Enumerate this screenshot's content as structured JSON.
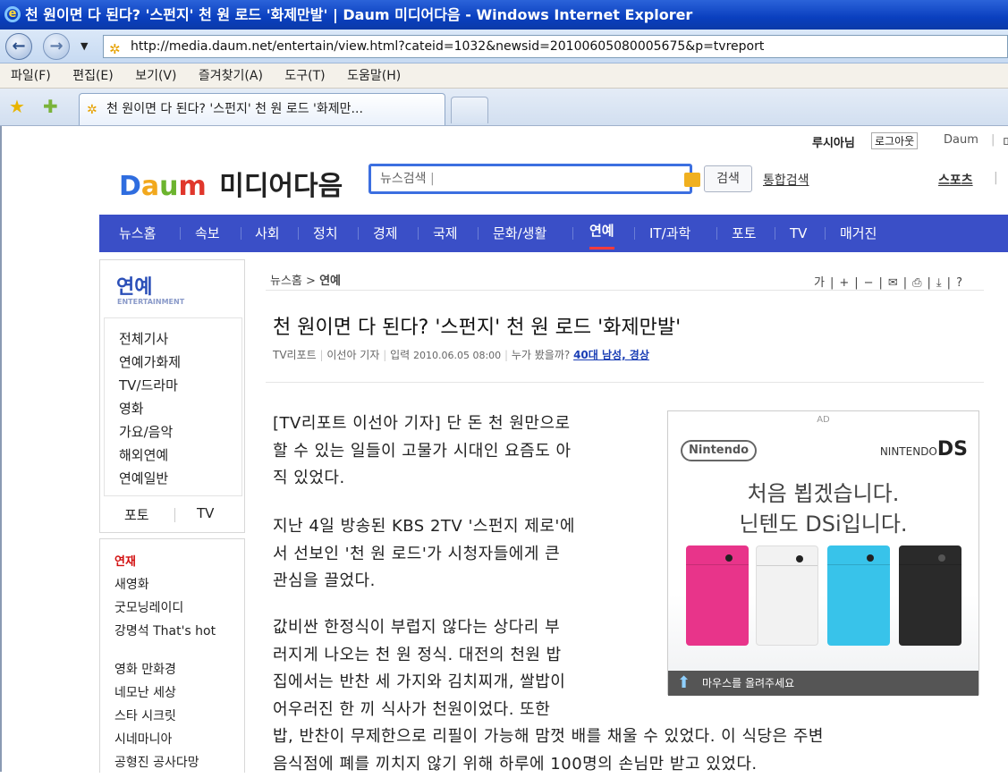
{
  "window": {
    "title": "천 원이면 다 된다? '스펀지' 천 원 로드 '화제만발' | Daum 미디어다음 - Windows Internet Explorer",
    "url": "http://media.daum.net/entertain/view.html?cateid=1032&newsid=20100605080005675&p=tvreport",
    "menu": [
      "파일(F)",
      "편집(E)",
      "보기(V)",
      "즐겨찾기(A)",
      "도구(T)",
      "도움말(H)"
    ],
    "tab_title": "천 원이면 다 된다? '스펀지' 천 원 로드 '화제만..."
  },
  "util": {
    "user": "루시아님",
    "logout": "로그아웃",
    "daum": "Daum",
    "sep": "|",
    "cut": "미"
  },
  "logo": {
    "d": "D",
    "a": "a",
    "u": "u",
    "m": "m",
    "text": "미디어다음"
  },
  "search": {
    "placeholder": "뉴스검색",
    "button": "검색",
    "total": "통합검색",
    "sports": "스포츠",
    "cut": "|"
  },
  "gnb": [
    "뉴스홈",
    "속보",
    "사회",
    "정치",
    "경제",
    "국제",
    "문화/생활",
    "연예",
    "IT/과학",
    "포토",
    "TV",
    "매거진"
  ],
  "lnb": {
    "title": "연예",
    "subtitle": "ENTERTAINMENT",
    "items": [
      "전체기사",
      "연예가화제",
      "TV/드라마",
      "영화",
      "가요/음악",
      "해외연예",
      "연예일반"
    ],
    "photo": "포토",
    "tv": "TV"
  },
  "lnb2": {
    "head": "연재",
    "items": [
      "새영화",
      "굿모닝레이디",
      "강명석 That's hot",
      "영화 만화경",
      "네모난 세상",
      "스타 시크릿",
      "시네마니아",
      "공형진 공사다망"
    ]
  },
  "article": {
    "breadcrumb_home": "뉴스홈",
    "breadcrumb_sep": ">",
    "breadcrumb_current": "연예",
    "tools": "가|+|−|✉|⎙|⤓|?",
    "headline": "천 원이면 다 된다? '스펀지' 천 원 로드 '화제만발'",
    "source": "TV리포트",
    "reporter": "이선아 기자",
    "date_label": "입력",
    "date": "2010.06.05 08:00",
    "who_label": "누가 봤을까?",
    "who_value": "40대 남성, 경상",
    "p1": [
      "[TV리포트 이선아 기자] 단 돈 천 원만으로",
      "할 수 있는 일들이 고물가 시대인 요즘도 아",
      "직 있었다."
    ],
    "p2": [
      "지난 4일 방송된 KBS 2TV '스펀지 제로'에",
      "서 선보인 '천 원 로드'가 시청자들에게 큰",
      "관심을 끌었다."
    ],
    "p3": [
      "값비싼 한정식이 부럽지 않다는 상다리 부",
      "러지게 나오는 천 원 정식. 대전의 천원 밥",
      "집에서는 반찬 세 가지와 김치찌개, 쌀밥이",
      "어우러진 한 끼 식사가 천원이었다. 또한",
      "밥, 반찬이 무제한으로 리필이 가능해 맘껏 배를 채울 수 있었다. 이 식당은 주변",
      "음식점에 폐를 끼치지 않기 위해 하루에 100명의 손님만 받고 있었다."
    ]
  },
  "ad": {
    "label": "AD",
    "brand": "Nintendo",
    "product_prefix": "NINTENDO",
    "product": "DS",
    "copy1": "처음 뵙겠습니다.",
    "copy2": "닌텐도 DSi입니다.",
    "bar": "마우스를 올려주세요",
    "colors": [
      "#e8348a",
      "#f2f2f2",
      "#38c3ea",
      "#2a2a2a"
    ]
  }
}
